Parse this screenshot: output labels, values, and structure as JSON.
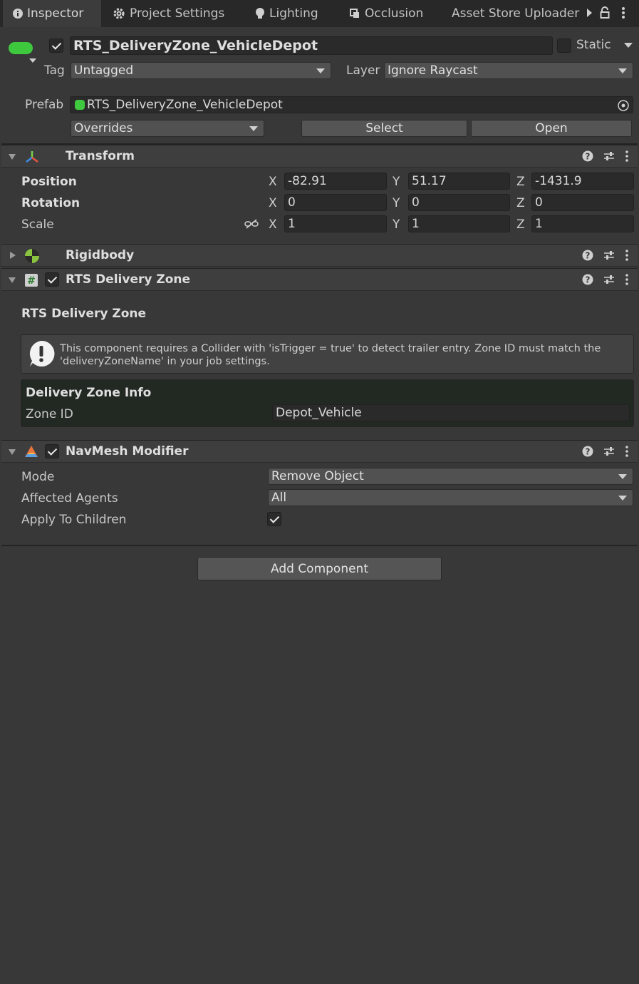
{
  "tabs": [
    {
      "label": "Inspector",
      "icon": "info-icon"
    },
    {
      "label": "Project Settings",
      "icon": "gear-icon"
    },
    {
      "label": "Lighting",
      "icon": "light-bulb-icon"
    },
    {
      "label": "Occlusion",
      "icon": "occlusion-icon"
    },
    {
      "label": "Asset Store Uploader",
      "icon": "store-icon"
    }
  ],
  "object": {
    "name": "RTS_DeliveryZone_VehicleDepot",
    "active": true,
    "static_label": "Static",
    "tag_label": "Tag",
    "tag_value": "Untagged",
    "layer_label": "Layer",
    "layer_value": "Ignore Raycast",
    "prefab_label": "Prefab",
    "prefab_value": "RTS_DeliveryZone_VehicleDepot",
    "overrides_label": "Overrides",
    "select_label": "Select",
    "open_label": "Open"
  },
  "transform": {
    "title": "Transform",
    "rows": [
      {
        "label": "Position",
        "x": "-82.91",
        "y": "51.17",
        "z": "-1431.9"
      },
      {
        "label": "Rotation",
        "x": "0",
        "y": "0",
        "z": "0"
      },
      {
        "label": "Scale",
        "x": "1",
        "y": "1",
        "z": "1"
      }
    ],
    "axis": {
      "x": "X",
      "y": "Y",
      "z": "Z"
    }
  },
  "rigidbody": {
    "title": "Rigidbody"
  },
  "delivery": {
    "title": "RTS Delivery Zone",
    "section_title": "RTS Delivery Zone",
    "warning": "This component requires a Collider with 'isTrigger = true' to detect trailer entry. Zone ID must match the 'deliveryZoneName' in your job settings.",
    "info_title": "Delivery Zone Info",
    "zone_id_label": "Zone ID",
    "zone_id_value": "Depot_Vehicle"
  },
  "navmesh": {
    "title": "NavMesh Modifier",
    "mode_label": "Mode",
    "mode_value": "Remove Object",
    "agents_label": "Affected Agents",
    "agents_value": "All",
    "children_label": "Apply To Children",
    "children_checked": true
  },
  "add_component_label": "Add Component",
  "colors": {
    "accent_green": "#3ec83e",
    "background": "#383838",
    "tab_bar": "#282828"
  }
}
